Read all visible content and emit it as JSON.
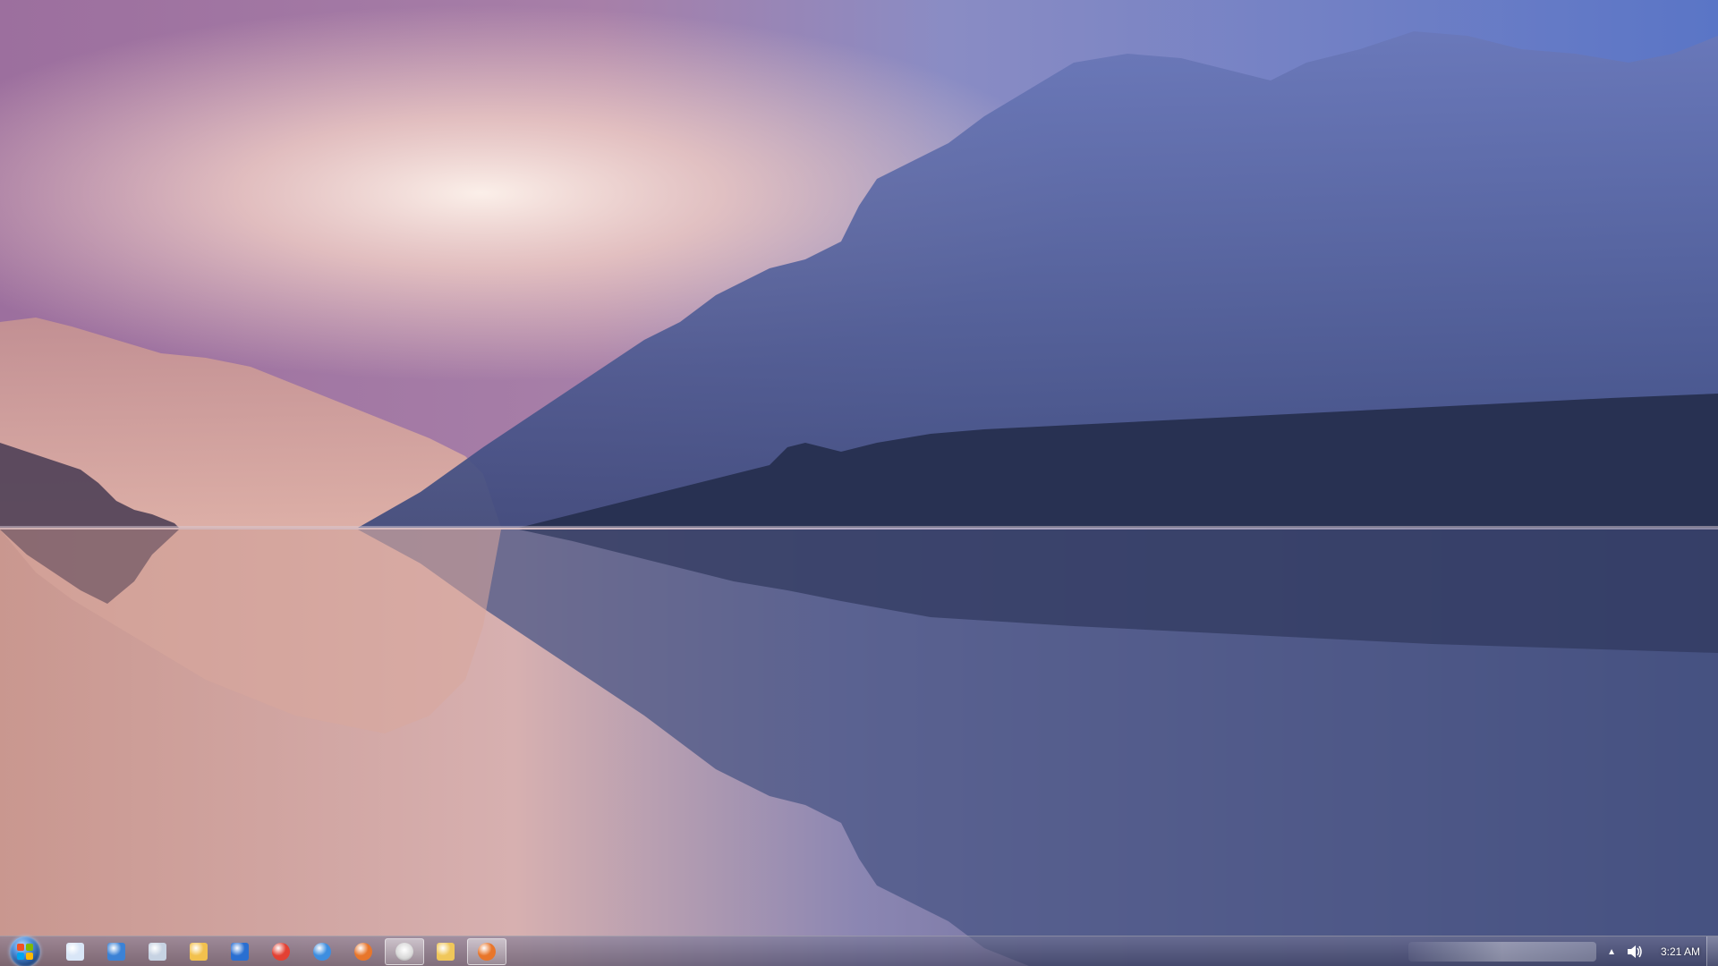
{
  "taskbar": {
    "clock": "3:21 AM",
    "start_label": "Start",
    "items": [
      {
        "icon": "notepad-icon",
        "color": "#d9e6f7"
      },
      {
        "icon": "sync-icon",
        "color": "#3b82d6"
      },
      {
        "icon": "calculator-icon",
        "color": "#c7d3e3"
      },
      {
        "icon": "paint-icon",
        "color": "#f2c14e"
      },
      {
        "icon": "network-icon",
        "color": "#2a6fd1"
      },
      {
        "icon": "chrome-icon",
        "color": "#e34133"
      },
      {
        "icon": "internet-explorer-icon",
        "color": "#3d8ee0"
      },
      {
        "icon": "firefox-icon",
        "color": "#e8762b"
      },
      {
        "icon": "alien-icon",
        "color": "#ffffff",
        "active": true
      },
      {
        "icon": "folder-icon",
        "color": "#f0c75a"
      },
      {
        "icon": "firefox-icon",
        "color": "#e8762b",
        "active": true
      }
    ]
  },
  "wallpaper": {
    "sky_top_left": "#9c6f9e",
    "sky_top_right": "#5a75c6",
    "glow": "#f7e6df",
    "mountain_far": "#c79a94",
    "mountain_near": "#4c5a8f",
    "forest": "#2b3556",
    "water": "#4a5585"
  }
}
